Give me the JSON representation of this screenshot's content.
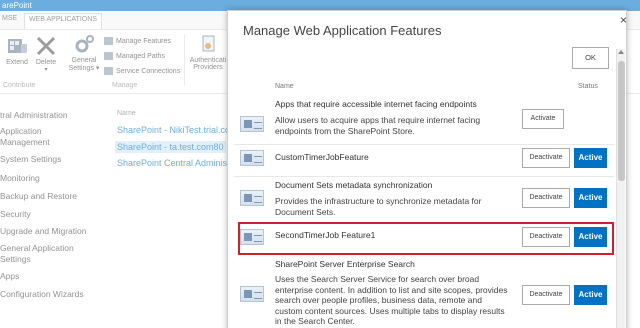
{
  "topbar": {
    "title": "arePoint"
  },
  "ribbon": {
    "tabs": [
      "MSE",
      "WEB APPLICATIONS"
    ],
    "buttons": {
      "extend": "Extend",
      "delete": "Delete",
      "general_settings_1": "General",
      "general_settings_2": "Settings ▾",
      "auth_1": "Authenticati",
      "auth_2": "Providers"
    },
    "small": {
      "manage_features": "Manage Features",
      "managed_paths": "Managed Paths",
      "service_connections": "Service Connections"
    },
    "groups": {
      "contribute": "Contribute",
      "manage": "Manage"
    }
  },
  "leftnav": {
    "items": [
      "tral Administration",
      "Application",
      "Management",
      "System Settings",
      "Monitoring",
      "Backup and Restore",
      "Security",
      "Upgrade and Migration",
      "General Application",
      "Settings",
      "Apps",
      "Configuration Wizards"
    ]
  },
  "content": {
    "header": "Name",
    "rows": [
      "SharePoint - NikiTest.trial.com",
      "SharePoint - ta.test.com80",
      "SharePoint Central Administra"
    ]
  },
  "dialog": {
    "title": "Manage Web Application Features",
    "close": "×",
    "ok": "OK",
    "header_name": "Name",
    "header_status": "Status",
    "features": [
      {
        "title": "Apps that require accessible internet facing endpoints",
        "desc": "Allow users to acquire apps that require internet facing endpoints from the SharePoint Store.",
        "button": "Activate",
        "status": ""
      },
      {
        "title": "CustomTimerJobFeature",
        "desc": "",
        "button": "Deactivate",
        "status": "Active"
      },
      {
        "title": "Document Sets metadata synchronization",
        "desc": "Provides the infrastructure to synchronize metadata for Document Sets.",
        "button": "Deactivate",
        "status": "Active"
      },
      {
        "title": "SecondTimerJob Feature1",
        "desc": "",
        "button": "Deactivate",
        "status": "Active"
      },
      {
        "title": "SharePoint Server Enterprise Search",
        "desc": "Uses the Search Server Service for search over broad enterprise content. In addition to list and site scopes, provides search over people profiles, business data, remote and custom content sources. Uses multiple tabs to display results in the Search Center.",
        "button": "Deactivate",
        "status": "Active"
      }
    ]
  },
  "colors": {
    "accent": "#0072c6",
    "highlight": "#d0202e"
  }
}
